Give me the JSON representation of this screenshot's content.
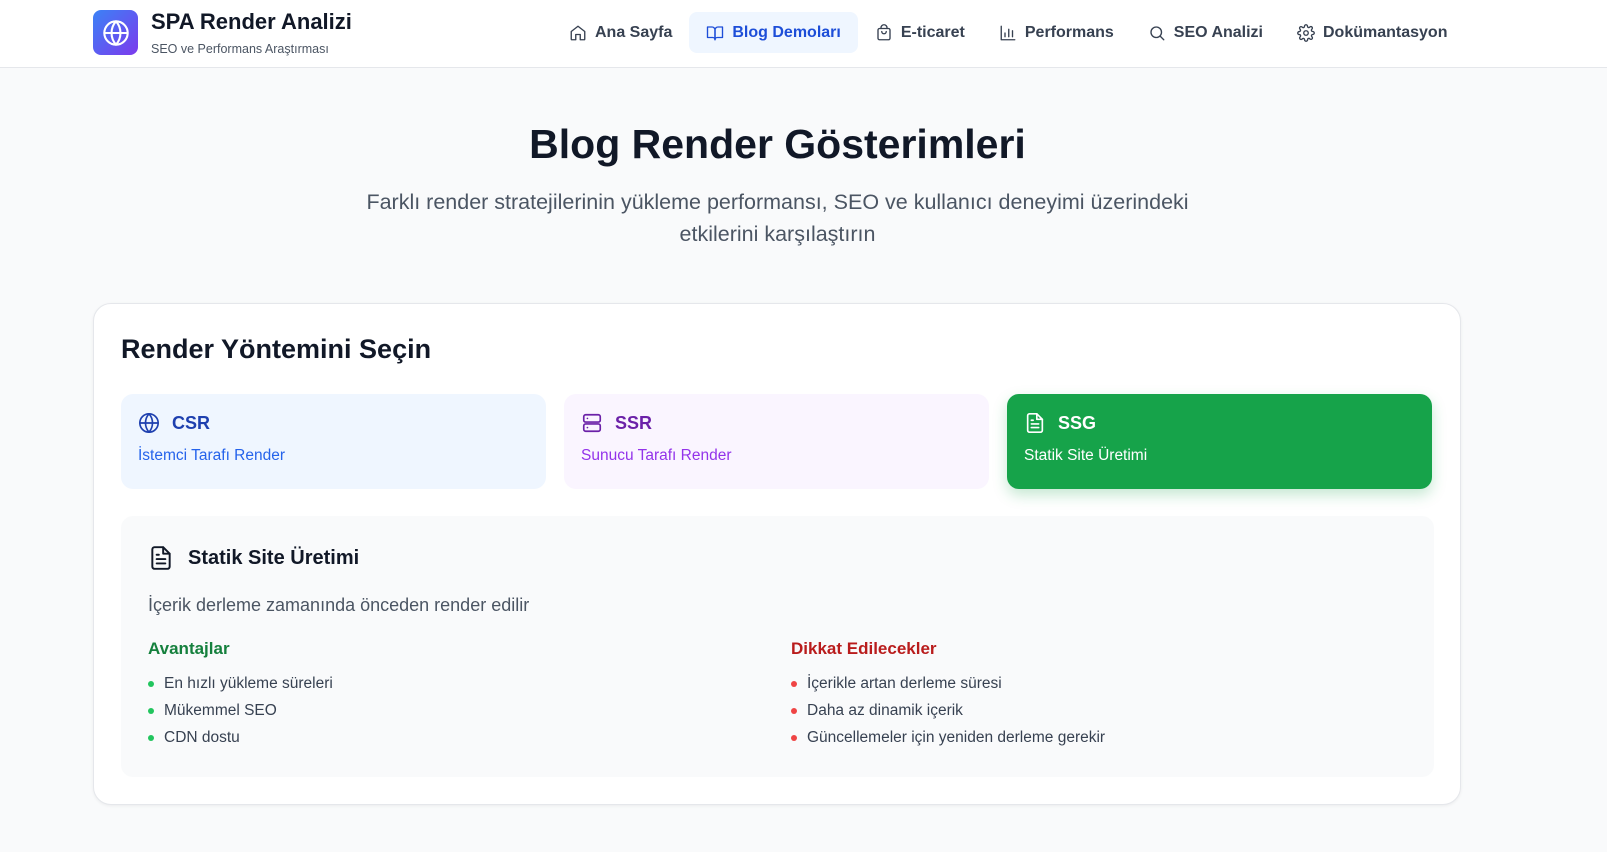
{
  "brand": {
    "title": "SPA Render Analizi",
    "subtitle": "SEO ve Performans Araştırması",
    "logo_icon": "globe-icon",
    "gradient_from": "#3b82f6",
    "gradient_to": "#7c3aed"
  },
  "nav": [
    {
      "label": "Ana Sayfa",
      "icon": "home-icon",
      "active": false
    },
    {
      "label": "Blog Demoları",
      "icon": "book-icon",
      "active": true
    },
    {
      "label": "E-ticaret",
      "icon": "shopping-bag-icon",
      "active": false
    },
    {
      "label": "Performans",
      "icon": "bar-chart-icon",
      "active": false
    },
    {
      "label": "SEO Analizi",
      "icon": "search-icon",
      "active": false
    },
    {
      "label": "Dokümantasyon",
      "icon": "gear-icon",
      "active": false
    }
  ],
  "hero": {
    "title": "Blog Render Gösterimleri",
    "subtitle": "Farklı render stratejilerinin yükleme performansı, SEO ve kullanıcı deneyimi üzerindeki etkilerini karşılaştırın"
  },
  "selector": {
    "title": "Render Yöntemini Seçin",
    "methods": [
      {
        "key": "csr",
        "label": "CSR",
        "description": "İstemci Tarafı Render",
        "icon": "globe-icon",
        "selected": false
      },
      {
        "key": "ssr",
        "label": "SSR",
        "description": "Sunucu Tarafı Render",
        "icon": "server-icon",
        "selected": false
      },
      {
        "key": "ssg",
        "label": "SSG",
        "description": "Statik Site Üretimi",
        "icon": "file-text-icon",
        "selected": true
      }
    ]
  },
  "detail": {
    "title": "Statik Site Üretimi",
    "description": "İçerik derleme zamanında önceden render edilir",
    "pros_title": "Avantajlar",
    "pros": [
      "En hızlı yükleme süreleri",
      "Mükemmel SEO",
      "CDN dostu"
    ],
    "cons_title": "Dikkat Edilecekler",
    "cons": [
      "İçerikle artan derleme süresi",
      "Daha az dinamik içerik",
      "Güncellemeler için yeniden derleme gerekir"
    ]
  },
  "colors": {
    "active_nav": "#1d4ed8",
    "ssg_selected": "#16a34a",
    "pros": "#15803d",
    "cons": "#b91c1c"
  }
}
